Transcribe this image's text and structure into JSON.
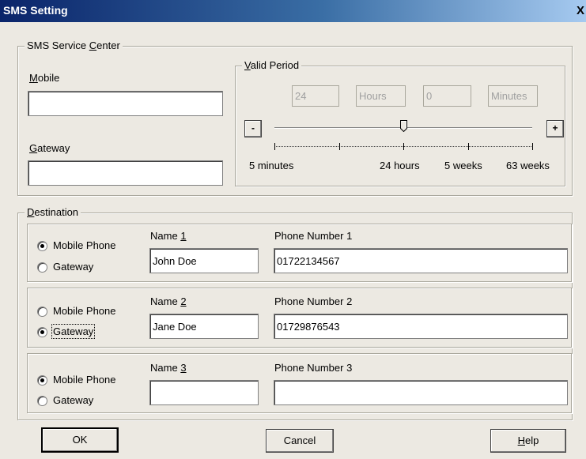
{
  "window": {
    "title": "SMS Setting",
    "close_glyph": "X"
  },
  "service_center": {
    "legend_pre": "SMS Service ",
    "legend_key": "C",
    "legend_post": "enter",
    "mobile_label_key": "M",
    "mobile_label_rest": "obile",
    "mobile_value": "",
    "gateway_label_key": "G",
    "gateway_label_rest": "ateway",
    "gateway_value": ""
  },
  "valid_period": {
    "legend_key": "V",
    "legend_rest": "alid Period",
    "field1": "24",
    "field2": "Hours",
    "field3": "0",
    "field4": "Minutes",
    "minus_label": "-",
    "plus_label": "+",
    "slider_level_fraction": 0.5,
    "tick_count": 5,
    "scale_labels": [
      "5 minutes",
      "24 hours",
      "5 weeks",
      "63 weeks"
    ]
  },
  "destination": {
    "legend_key": "D",
    "legend_rest": "estination",
    "phone_label": "Phone Number",
    "name_label": "Name",
    "rows": [
      {
        "mobile_label": "Mobile Phone",
        "gateway_label": "Gateway",
        "selected": "mobile",
        "name_num": "1",
        "phone_num": "1",
        "name_value": "John Doe",
        "phone_value": "01722134567"
      },
      {
        "mobile_label": "Mobile Phone",
        "gateway_label": "Gateway",
        "selected": "gateway",
        "name_num": "2",
        "phone_num": "2",
        "name_value": "Jane Doe",
        "phone_value": "01729876543"
      },
      {
        "mobile_label": "Mobile Phone",
        "gateway_label": "Gateway",
        "selected": "mobile",
        "name_num": "3",
        "phone_num": "3",
        "name_value": "",
        "phone_value": ""
      }
    ]
  },
  "buttons": {
    "ok": "OK",
    "cancel": "Cancel",
    "help_key": "H",
    "help_rest": "elp"
  }
}
